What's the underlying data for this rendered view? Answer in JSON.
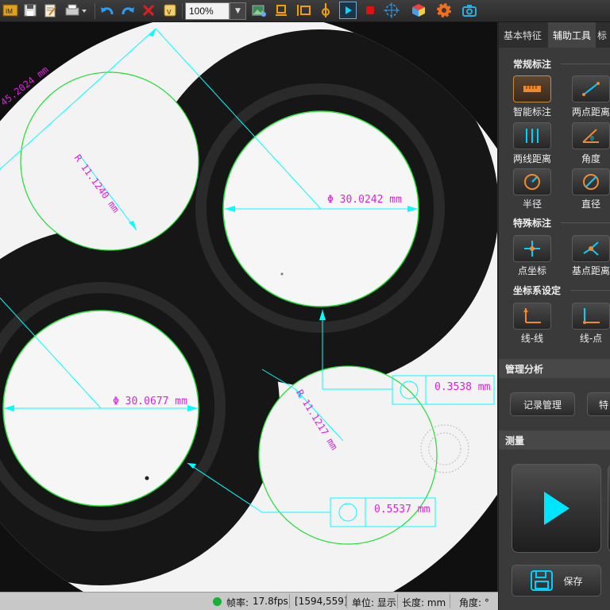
{
  "toolbar": {
    "zoom_value": "100%",
    "tools": [
      {
        "name": "app-logo-icon"
      },
      {
        "name": "save-icon"
      },
      {
        "name": "edit-notes-icon"
      },
      {
        "name": "print-icon"
      },
      {
        "name": "undo-icon"
      },
      {
        "name": "redo-icon"
      },
      {
        "name": "delete-icon"
      },
      {
        "name": "v-icon"
      },
      {
        "name": "image-settings-icon"
      },
      {
        "name": "horizontal-align-icon"
      },
      {
        "name": "vertical-align-icon"
      },
      {
        "name": "probe-icon"
      },
      {
        "name": "play-icon"
      },
      {
        "name": "stop-icon"
      },
      {
        "name": "crosshair-icon"
      },
      {
        "name": "color-cube-icon"
      },
      {
        "name": "gear-icon"
      },
      {
        "name": "camera-icon"
      }
    ]
  },
  "colors": {
    "annotation_cyan": "#00ffff",
    "annotation_magenta": "#dd22dd",
    "edge_green": "#22dd33",
    "selected_border": "#c78b3c",
    "play_cyan": "#00e5ff"
  },
  "canvas": {
    "annotations": {
      "dim_45": "45.2024 mm",
      "radius_left": "R 11.1240 mm",
      "diam_top": "Φ 30.0242 mm",
      "diam_bottom": "Φ 30.0677 mm",
      "radius_right": "R 11.1217 mm",
      "circularity_1": "0.3538 mm",
      "circularity_2": "0.5537 mm"
    }
  },
  "panel": {
    "tabs": [
      "基本特征",
      "辅助工具",
      "标"
    ],
    "section_regular": "常规标注",
    "regular_tools": [
      "智能标注",
      "两点距离",
      "两线距离",
      "角度",
      "半径",
      "直径"
    ],
    "section_special": "特殊标注",
    "special_tools": [
      "点坐标",
      "基点距离"
    ],
    "section_coord": "坐标系设定",
    "coord_tools": [
      "线-线",
      "线-点"
    ],
    "section_manage": "管理分析",
    "manage_buttons": [
      "记录管理",
      "特"
    ],
    "section_measure": "测量",
    "save_label": "保存"
  },
  "status": {
    "fps_label": "帧率:",
    "fps_value": "17.8fps",
    "coords": "[1594,559]",
    "unit_label": "单位: 显示",
    "length_label": "长度: mm",
    "angle_label": "角度: °"
  }
}
